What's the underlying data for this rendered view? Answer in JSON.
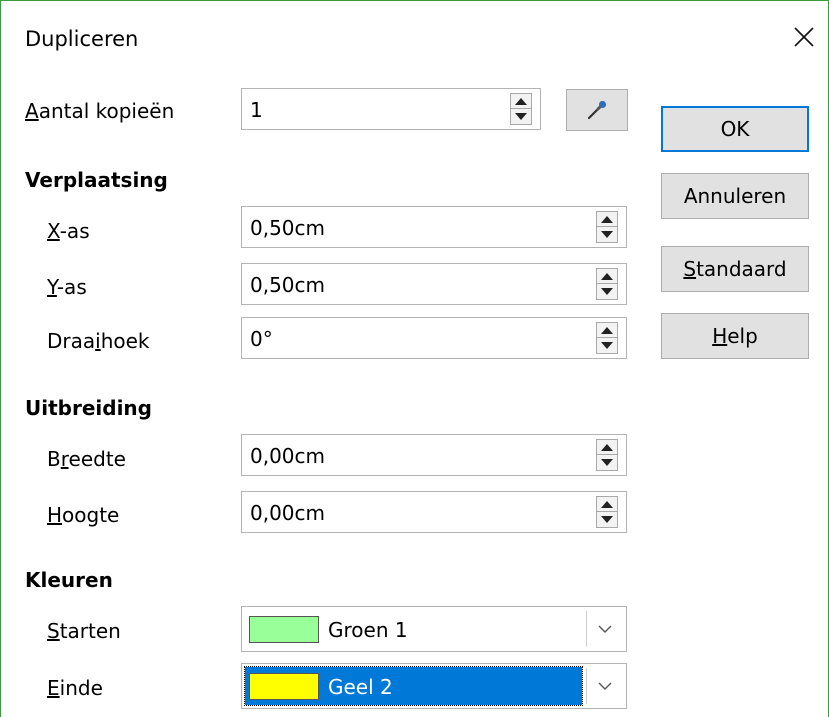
{
  "window": {
    "title": "Dupliceren"
  },
  "copies": {
    "label_pre": "",
    "label_ul": "A",
    "label_post": "antal kopieën",
    "value": "1"
  },
  "displacement": {
    "heading": "Verplaatsing",
    "x": {
      "label_ul": "X",
      "label_post": "-as",
      "value": "0,50cm"
    },
    "y": {
      "label_ul": "Y",
      "label_post": "-as",
      "value": "0,50cm"
    },
    "angle": {
      "label_pre": "Draa",
      "label_ul": "i",
      "label_post": "hoek",
      "value": "0°"
    }
  },
  "enlargement": {
    "heading": "Uitbreiding",
    "width": {
      "label_pre": "B",
      "label_ul": "r",
      "label_post": "eedte",
      "value": "0,00cm"
    },
    "height": {
      "label_ul": "H",
      "label_post": "oogte",
      "value": "0,00cm"
    }
  },
  "colors": {
    "heading": "Kleuren",
    "start": {
      "label_ul": "S",
      "label_post": "tarten",
      "value": "Groen 1",
      "swatch": "#99ff99"
    },
    "end": {
      "label_ul": "E",
      "label_post": "inde",
      "value": "Geel 2",
      "swatch": "#ffff00"
    }
  },
  "buttons": {
    "ok": "OK",
    "cancel": "Annuleren",
    "default_ul": "S",
    "default_post": "tandaard",
    "help_ul": "H",
    "help_post": "elp"
  },
  "accent": "#0078d7",
  "border_color": "#3d9b3f"
}
